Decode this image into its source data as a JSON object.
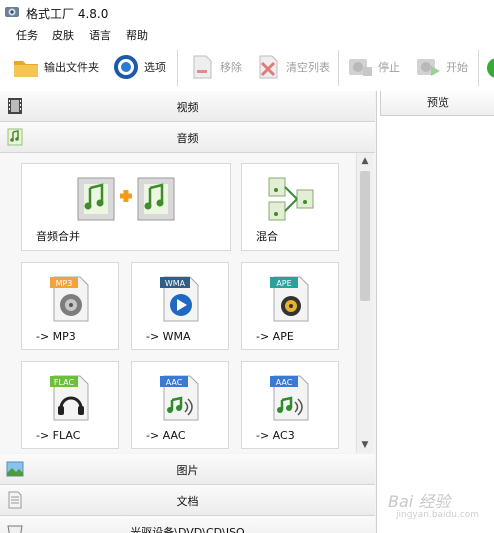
{
  "window": {
    "title": "格式工厂 4.8.0"
  },
  "menu": [
    "任务",
    "皮肤",
    "语言",
    "帮助"
  ],
  "toolbar": {
    "output_folder": "输出文件夹",
    "options": "选项",
    "remove": "移除",
    "clear_list": "清空列表",
    "stop": "停止",
    "start": "开始"
  },
  "categories": {
    "video": "视频",
    "audio": "音频",
    "image": "图片",
    "document": "文档",
    "disc": "光驱设备\\DVD\\CD\\ISO"
  },
  "audio_tools": [
    {
      "label": "音频合并",
      "badge": ""
    },
    {
      "label": "混合",
      "badge": ""
    },
    {
      "label": "-> MP3",
      "badge": "MP3"
    },
    {
      "label": "-> WMA",
      "badge": "WMA"
    },
    {
      "label": "-> APE",
      "badge": "APE"
    },
    {
      "label": "-> FLAC",
      "badge": "FLAC"
    },
    {
      "label": "-> AAC",
      "badge": "AAC"
    },
    {
      "label": "-> AC3",
      "badge": "AAC"
    }
  ],
  "preview": {
    "header": "预览"
  },
  "watermark": {
    "text": "Bai 经验",
    "sub": "jingyan.baidu.com"
  },
  "colors": {
    "toolbar_bg": "#ffffff",
    "pane_bg": "#f3f3f3",
    "mp3_badge": "#f2a43a",
    "wma_badge": "#2f5f86",
    "ape_badge": "#29a19c",
    "flac_badge": "#6bbf3a",
    "aac_badge": "#3a79d4"
  }
}
